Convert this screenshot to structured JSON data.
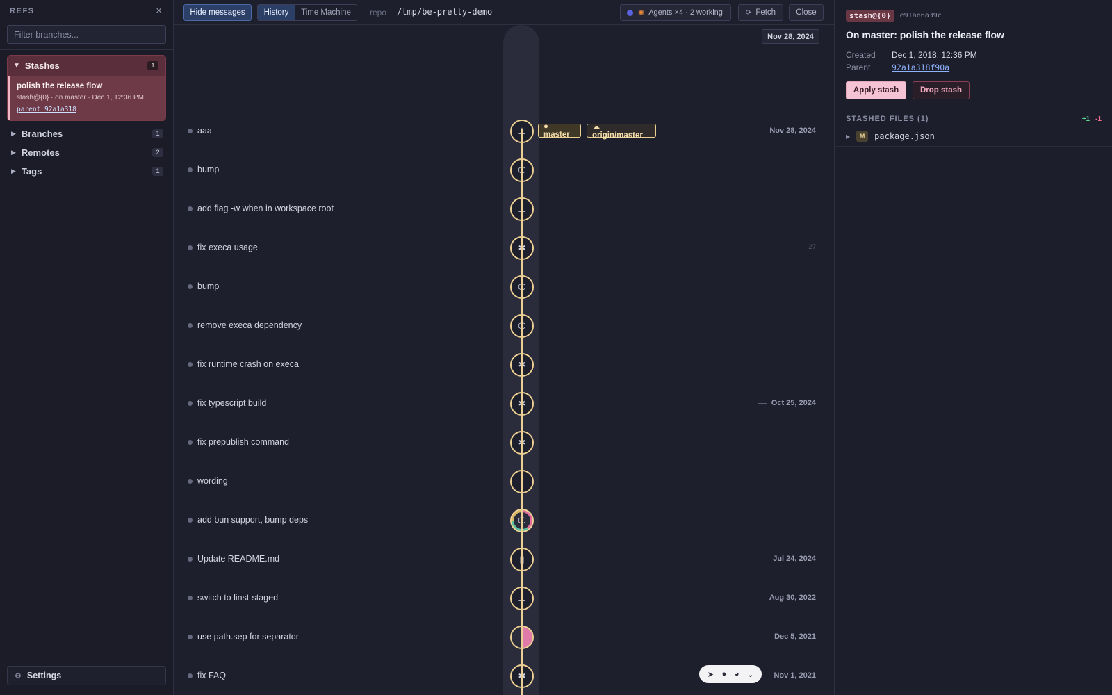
{
  "sidebar": {
    "title": "REFS",
    "close_icon": "×",
    "filter_placeholder": "Filter branches...",
    "stashes": {
      "label": "Stashes",
      "count": "1",
      "item": {
        "title": "polish the release flow",
        "meta": "stash@{0} · on master · Dec 1, 12:36 PM",
        "parent": "parent 92a1a318"
      }
    },
    "sections": [
      {
        "label": "Branches",
        "count": "1"
      },
      {
        "label": "Remotes",
        "count": "2"
      },
      {
        "label": "Tags",
        "count": "1"
      }
    ],
    "settings_label": "Settings"
  },
  "toolbar": {
    "hide_messages": "Hide messages",
    "history": "History",
    "time_machine": "Time Machine",
    "repo_label": "repo",
    "repo_path": "/tmp/be-pretty-demo",
    "agents": "Agents ×4 · 2 working",
    "fetch": "Fetch",
    "close": "Close"
  },
  "timeline": {
    "top_date": "Nov 28, 2024",
    "tags": {
      "master": "● master",
      "origin": "☁ origin/master"
    },
    "commits": [
      {
        "message": "aaa",
        "icon": "⊥",
        "date": "Nov 28, 2024"
      },
      {
        "message": "bump",
        "icon": "⬡",
        "date": ""
      },
      {
        "message": "add flag -w when in workspace root",
        "icon": "⊥",
        "date": ""
      },
      {
        "message": "fix execa usage",
        "icon": "✱",
        "date": "27",
        "faint": true
      },
      {
        "message": "bump",
        "icon": "⬡",
        "date": ""
      },
      {
        "message": "remove execa dependency",
        "icon": "⬡",
        "date": ""
      },
      {
        "message": "fix runtime crash on execa",
        "icon": "✱",
        "date": ""
      },
      {
        "message": "fix typescript build",
        "icon": "✱",
        "date": "Oct 25, 2024"
      },
      {
        "message": "fix prepublish command",
        "icon": "✱",
        "date": ""
      },
      {
        "message": "wording",
        "icon": "⊥",
        "date": ""
      },
      {
        "message": "add bun support, bump deps",
        "icon": "⬡",
        "date": "",
        "kind": "mixed"
      },
      {
        "message": "Update README.md",
        "icon": "▯",
        "date": "Jul 24, 2024"
      },
      {
        "message": "switch to linst-staged",
        "icon": "⊥",
        "date": "Aug 30, 2022"
      },
      {
        "message": "use path.sep for separator",
        "icon": "",
        "date": "Dec 5, 2021",
        "kind": "half"
      },
      {
        "message": "fix FAQ",
        "icon": "✱",
        "date": "Nov 1, 2021"
      }
    ],
    "mini_toolbar": [
      "➤",
      "●",
      "◕",
      "⌄"
    ]
  },
  "detail": {
    "stash_ref": "stash@{0}",
    "sha": "e91ae6a39c",
    "title": "On master: polish the release flow",
    "created_label": "Created",
    "created_value": "Dec 1, 2018, 12:36 PM",
    "parent_label": "Parent",
    "parent_value": "92a1a318f90a",
    "apply": "Apply stash",
    "drop": "Drop stash",
    "files_header": "STASHED FILES (1)",
    "additions": "+1",
    "deletions": "-1",
    "files": [
      {
        "status": "M",
        "name": "package.json"
      }
    ]
  }
}
